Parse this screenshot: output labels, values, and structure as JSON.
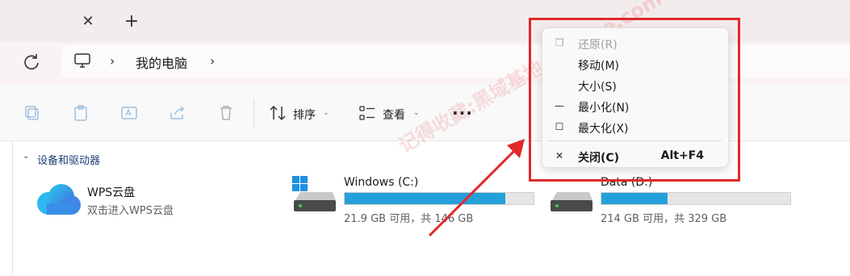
{
  "tabbar": {
    "close_glyph": "✕",
    "new_tab_glyph": "+"
  },
  "address": {
    "crumbs": [
      "我的电脑"
    ],
    "chevron": "›"
  },
  "toolbar": {
    "sort_label": "排序",
    "view_label": "查看",
    "more_label": "···",
    "caret": "⌄"
  },
  "section": {
    "title": "设备和驱动器",
    "chevron": "⌄"
  },
  "items": {
    "wps": {
      "title": "WPS云盘",
      "subtitle": "双击进入WPS云盘"
    },
    "c": {
      "title": "Windows (C:)",
      "usage": "21.9 GB 可用，共 146 GB",
      "used_fraction": 0.85
    },
    "d": {
      "title": "Data (D:)",
      "usage": "214 GB 可用，共 329 GB",
      "used_fraction": 0.35
    }
  },
  "context_menu": {
    "items": [
      {
        "label": "还原(R)",
        "icon": "❐",
        "disabled": true
      },
      {
        "label": "移动(M)",
        "icon": "",
        "disabled": false
      },
      {
        "label": "大小(S)",
        "icon": "",
        "disabled": false
      },
      {
        "label": "最小化(N)",
        "icon": "—",
        "disabled": false
      },
      {
        "label": "最大化(X)",
        "icon": "☐",
        "disabled": false
      },
      {
        "label": "关闭(C)",
        "icon": "✕",
        "disabled": false,
        "shortcut": "Alt+F4"
      }
    ]
  },
  "watermark": "记得收藏:黑域基地 hybase.com",
  "colors": {
    "accent": "#26a0da",
    "annotation": "#e0292a"
  }
}
